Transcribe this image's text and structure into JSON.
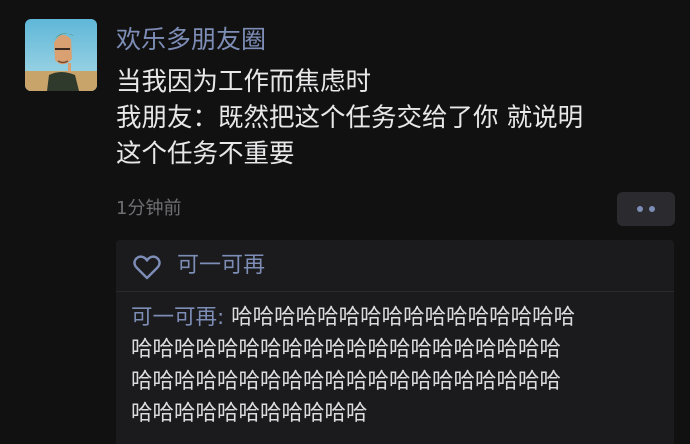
{
  "post": {
    "author": "欢乐多朋友圈",
    "text_lines": [
      "当我因为工作而焦虑时",
      "我朋友：既然把这个任务交给了你 就说明",
      "这个任务不重要"
    ],
    "time": "1分钟前",
    "more_icon": "more-dots-icon"
  },
  "likes": {
    "icon": "heart-outline-icon",
    "names": "可一可再"
  },
  "comment": {
    "author": "可一可再",
    "separator": ": ",
    "first_line": "哈哈哈哈哈哈哈哈哈哈哈哈哈哈哈哈",
    "lines": [
      "哈哈哈哈哈哈哈哈哈哈哈哈哈哈哈哈哈哈哈哈",
      "哈哈哈哈哈哈哈哈哈哈哈哈哈哈哈哈哈哈哈哈",
      "哈哈哈哈哈哈哈哈哈哈哈"
    ]
  },
  "colors": {
    "background": "#111112",
    "name_link": "#7d8db6",
    "panel": "#1b1b1d"
  }
}
